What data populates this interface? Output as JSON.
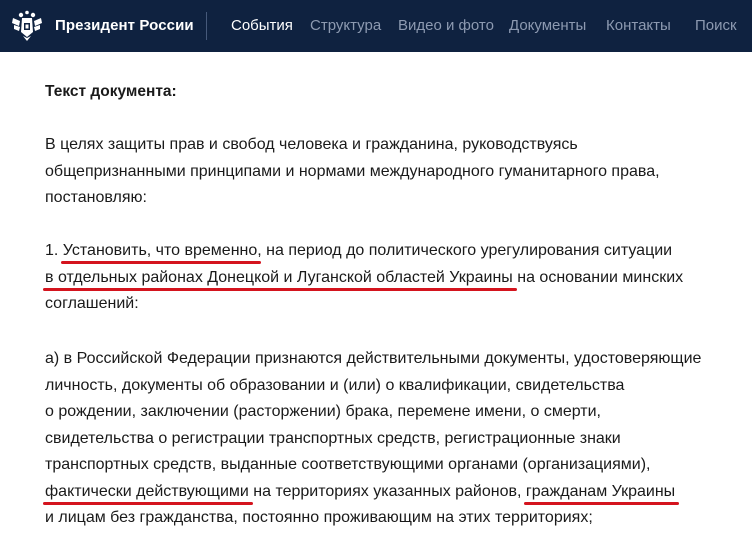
{
  "header": {
    "site_title": "Президент России",
    "nav": [
      {
        "label": "События",
        "active": true
      },
      {
        "label": "Структура",
        "active": false
      },
      {
        "label": "Видео и фото",
        "active": false
      },
      {
        "label": "Документы",
        "active": false
      },
      {
        "label": "Контакты",
        "active": false
      },
      {
        "label": "Поиск",
        "active": false
      }
    ]
  },
  "document": {
    "heading": "Текст документа:",
    "preamble": [
      "В целях защиты прав и свобод человека и гражданина, руководствуясь",
      "общепризнанными принципами и нормами международного гуманитарного права,",
      "постановляю:"
    ],
    "item1": {
      "number": "1. ",
      "underlined_1": "Установить, что временно",
      "text_1": ", на период до политического урегулирования ситуации",
      "underlined_2": "в отдельных районах Донецкой и Луганской областей Украины",
      "text_2": " на основании минских",
      "line_3": "соглашений:"
    },
    "item_a": {
      "line_1": "а) в Российской Федерации признаются действительными документы, удостоверяющие",
      "line_2": "личность, документы об образовании и (или) о квалификации, свидетельства",
      "line_3": "о рождении, заключении (расторжении) брака, перемене имени, о смерти,",
      "line_4": "свидетельства о регистрации транспортных средств, регистрационные знаки",
      "line_5": "транспортных средств, выданные соответствующими органами (организациями),",
      "underlined_1": "фактически действующими",
      "text_mid": " на территориях указанных районов, ",
      "underlined_2": "гражданам Украины",
      "text_end": "",
      "line_7": "и лицам без гражданства, постоянно проживающим на этих территориях;"
    }
  },
  "colors": {
    "header_bg": "#0f2240",
    "nav_inactive": "#8d9ab1",
    "underline": "#d4141e"
  }
}
